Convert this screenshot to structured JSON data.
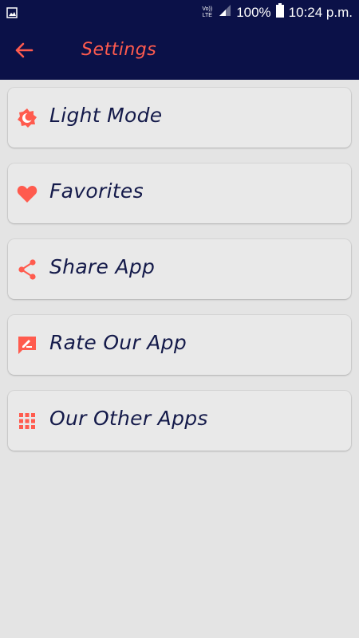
{
  "status_bar": {
    "network_top": "Vo))",
    "network_bottom": "LTE",
    "battery": "100%",
    "time": "10:24 p.m."
  },
  "app_bar": {
    "title": "Settings"
  },
  "menu": {
    "items": [
      {
        "label": "Light Mode",
        "icon": "theme-mode-icon"
      },
      {
        "label": "Favorites",
        "icon": "heart-icon"
      },
      {
        "label": "Share App",
        "icon": "share-icon"
      },
      {
        "label": "Rate Our App",
        "icon": "rate-review-icon"
      },
      {
        "label": "Our Other Apps",
        "icon": "apps-grid-icon"
      }
    ]
  },
  "colors": {
    "bar_background": "#0b1148",
    "accent": "#ff5b4e",
    "text": "#141a4a",
    "page_background": "#e4e4e4"
  }
}
